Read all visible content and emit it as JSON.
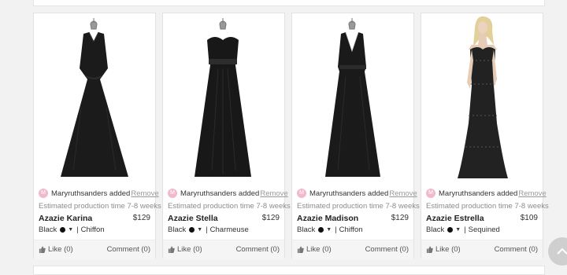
{
  "cards": [
    {
      "added_by": "Maryruthsanders added",
      "remove_label": "Remove",
      "production": "Estimated production time 7-8 weeks",
      "name": "Azazie Karina",
      "price": "$129",
      "color": "Black",
      "fabric": "Chiffon",
      "like": "Like (0)",
      "comment": "Comment (0)",
      "avatar_letter": "M"
    },
    {
      "added_by": "Maryruthsanders added",
      "remove_label": "Remove",
      "production": "Estimated production time 7-8 weeks",
      "name": "Azazie Stella",
      "price": "$129",
      "color": "Black",
      "fabric": "Charmeuse",
      "like": "Like (0)",
      "comment": "Comment (0)",
      "avatar_letter": "M"
    },
    {
      "added_by": "Maryruthsanders added",
      "remove_label": "Remove",
      "production": "Estimated production time 7-8 weeks",
      "name": "Azazie Madison",
      "price": "$129",
      "color": "Black",
      "fabric": "Chiffon",
      "like": "Like (0)",
      "comment": "Comment (0)",
      "avatar_letter": "M"
    },
    {
      "added_by": "Maryruthsanders added",
      "remove_label": "Remove",
      "production": "Estimated production time 7-8 weeks",
      "name": "Azazie Estrella",
      "price": "$109",
      "color": "Black",
      "fabric": "Sequined",
      "like": "Like (0)",
      "comment": "Comment (0)",
      "avatar_letter": "M"
    }
  ],
  "colors": {
    "avatar": "#f1b9cc",
    "swatch": "#111111",
    "card_bg": "#ffffff",
    "footer_bg": "#f5f5f5"
  },
  "icons": {
    "like": "thumbs-up-icon",
    "scroll": "chevron-up-icon"
  }
}
